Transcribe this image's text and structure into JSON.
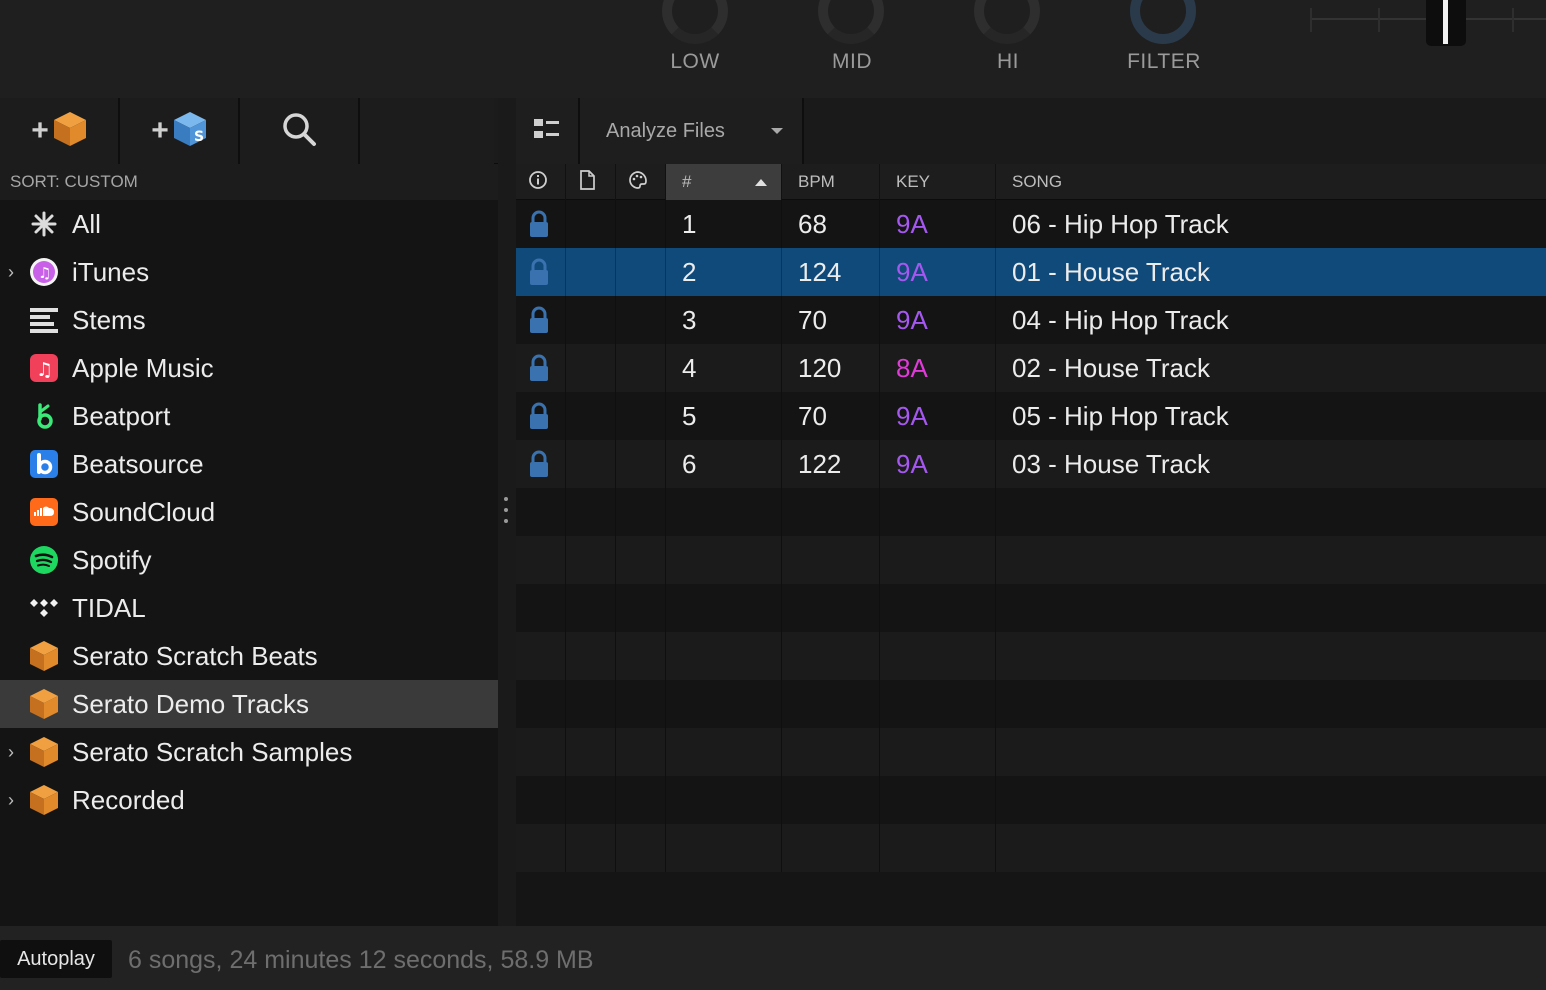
{
  "eq": {
    "low": "LOW",
    "mid": "MID",
    "hi": "HI",
    "filter": "FILTER"
  },
  "library": {
    "sort_label": "SORT: CUSTOM",
    "crates": [
      {
        "label": "All",
        "icon": "all-asterisk-icon",
        "expandable": false
      },
      {
        "label": "iTunes",
        "icon": "itunes-icon",
        "expandable": true
      },
      {
        "label": "Stems",
        "icon": "stems-icon",
        "expandable": false
      },
      {
        "label": "Apple Music",
        "icon": "apple-music-icon",
        "expandable": false
      },
      {
        "label": "Beatport",
        "icon": "beatport-icon",
        "expandable": false
      },
      {
        "label": "Beatsource",
        "icon": "beatsource-icon",
        "expandable": false
      },
      {
        "label": "SoundCloud",
        "icon": "soundcloud-icon",
        "expandable": false
      },
      {
        "label": "Spotify",
        "icon": "spotify-icon",
        "expandable": false
      },
      {
        "label": "TIDAL",
        "icon": "tidal-icon",
        "expandable": false
      },
      {
        "label": "Serato Scratch Beats",
        "icon": "serato-crate-icon",
        "expandable": false
      },
      {
        "label": "Serato Demo Tracks",
        "icon": "serato-crate-icon",
        "expandable": false,
        "selected": true
      },
      {
        "label": "Serato Scratch Samples",
        "icon": "serato-crate-icon",
        "expandable": true
      },
      {
        "label": "Recorded",
        "icon": "serato-crate-icon",
        "expandable": true
      }
    ]
  },
  "tracks_toolbar": {
    "analyze_label": "Analyze Files"
  },
  "columns": {
    "num": "#",
    "bpm": "BPM",
    "key": "KEY",
    "song": "SONG"
  },
  "tracks": [
    {
      "num": "1",
      "bpm": "68",
      "key": "9A",
      "song": "06 - Hip Hop Track"
    },
    {
      "num": "2",
      "bpm": "124",
      "key": "9A",
      "song": "01 - House Track",
      "selected": true
    },
    {
      "num": "3",
      "bpm": "70",
      "key": "9A",
      "song": "04 - Hip Hop Track"
    },
    {
      "num": "4",
      "bpm": "120",
      "key": "8A",
      "song": "02 - House Track"
    },
    {
      "num": "5",
      "bpm": "70",
      "key": "9A",
      "song": "05 - Hip Hop Track"
    },
    {
      "num": "6",
      "bpm": "122",
      "key": "9A",
      "song": "03 - House Track"
    }
  ],
  "status": {
    "autoplay": "Autoplay",
    "summary": "6 songs, 24 minutes 12 seconds, 58.9 MB"
  },
  "colors": {
    "selection": "#0f4a7a",
    "key_9a": "#a558f0",
    "key_8a": "#e03ad8",
    "lock": "#3a72b0",
    "serato_orange": "#e08a2c"
  }
}
